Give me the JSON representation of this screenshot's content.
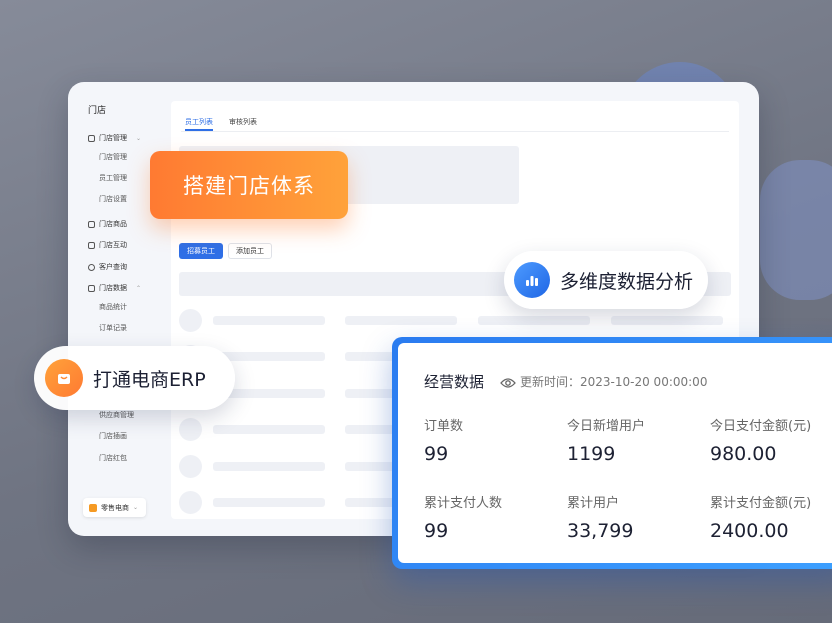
{
  "sidebar": {
    "title": "门店",
    "groups": [
      {
        "label": "门店管理",
        "sub": [
          "门店管理",
          "员工管理",
          "门店设置"
        ]
      },
      {
        "label": "门店商品"
      },
      {
        "label": "门店互动"
      },
      {
        "label": "客户查询"
      },
      {
        "label": "门店数据",
        "sub": [
          "商品统计",
          "订单记录"
        ]
      }
    ],
    "more_sub": [
      "供应商管理",
      "门店插画",
      "门店红包"
    ],
    "switch_label": "零售电商"
  },
  "tabs": [
    {
      "label": "员工列表",
      "active": true
    },
    {
      "label": "审核列表",
      "active": false
    }
  ],
  "buttons": {
    "primary": "招募员工",
    "secondary": "添加员工"
  },
  "callouts": {
    "store_system": "搭建门店体系",
    "erp": "打通电商ERP",
    "analysis": "多维度数据分析"
  },
  "stats": {
    "title": "经营数据",
    "update_time": "更新时间：2023-10-20 00:00:00",
    "items": [
      {
        "label": "订单数",
        "value": "99"
      },
      {
        "label": "今日新增用户",
        "value": "1199"
      },
      {
        "label": "今日支付金额(元)",
        "value": "980.00"
      },
      {
        "label": "累计支付人数",
        "value": "99"
      },
      {
        "label": "累计用户",
        "value": "33,799"
      },
      {
        "label": "累计支付金额(元)",
        "value": "2400.00"
      }
    ]
  },
  "colors": {
    "accent_blue": "#2f6fe6",
    "accent_orange": "#ff7a32"
  }
}
